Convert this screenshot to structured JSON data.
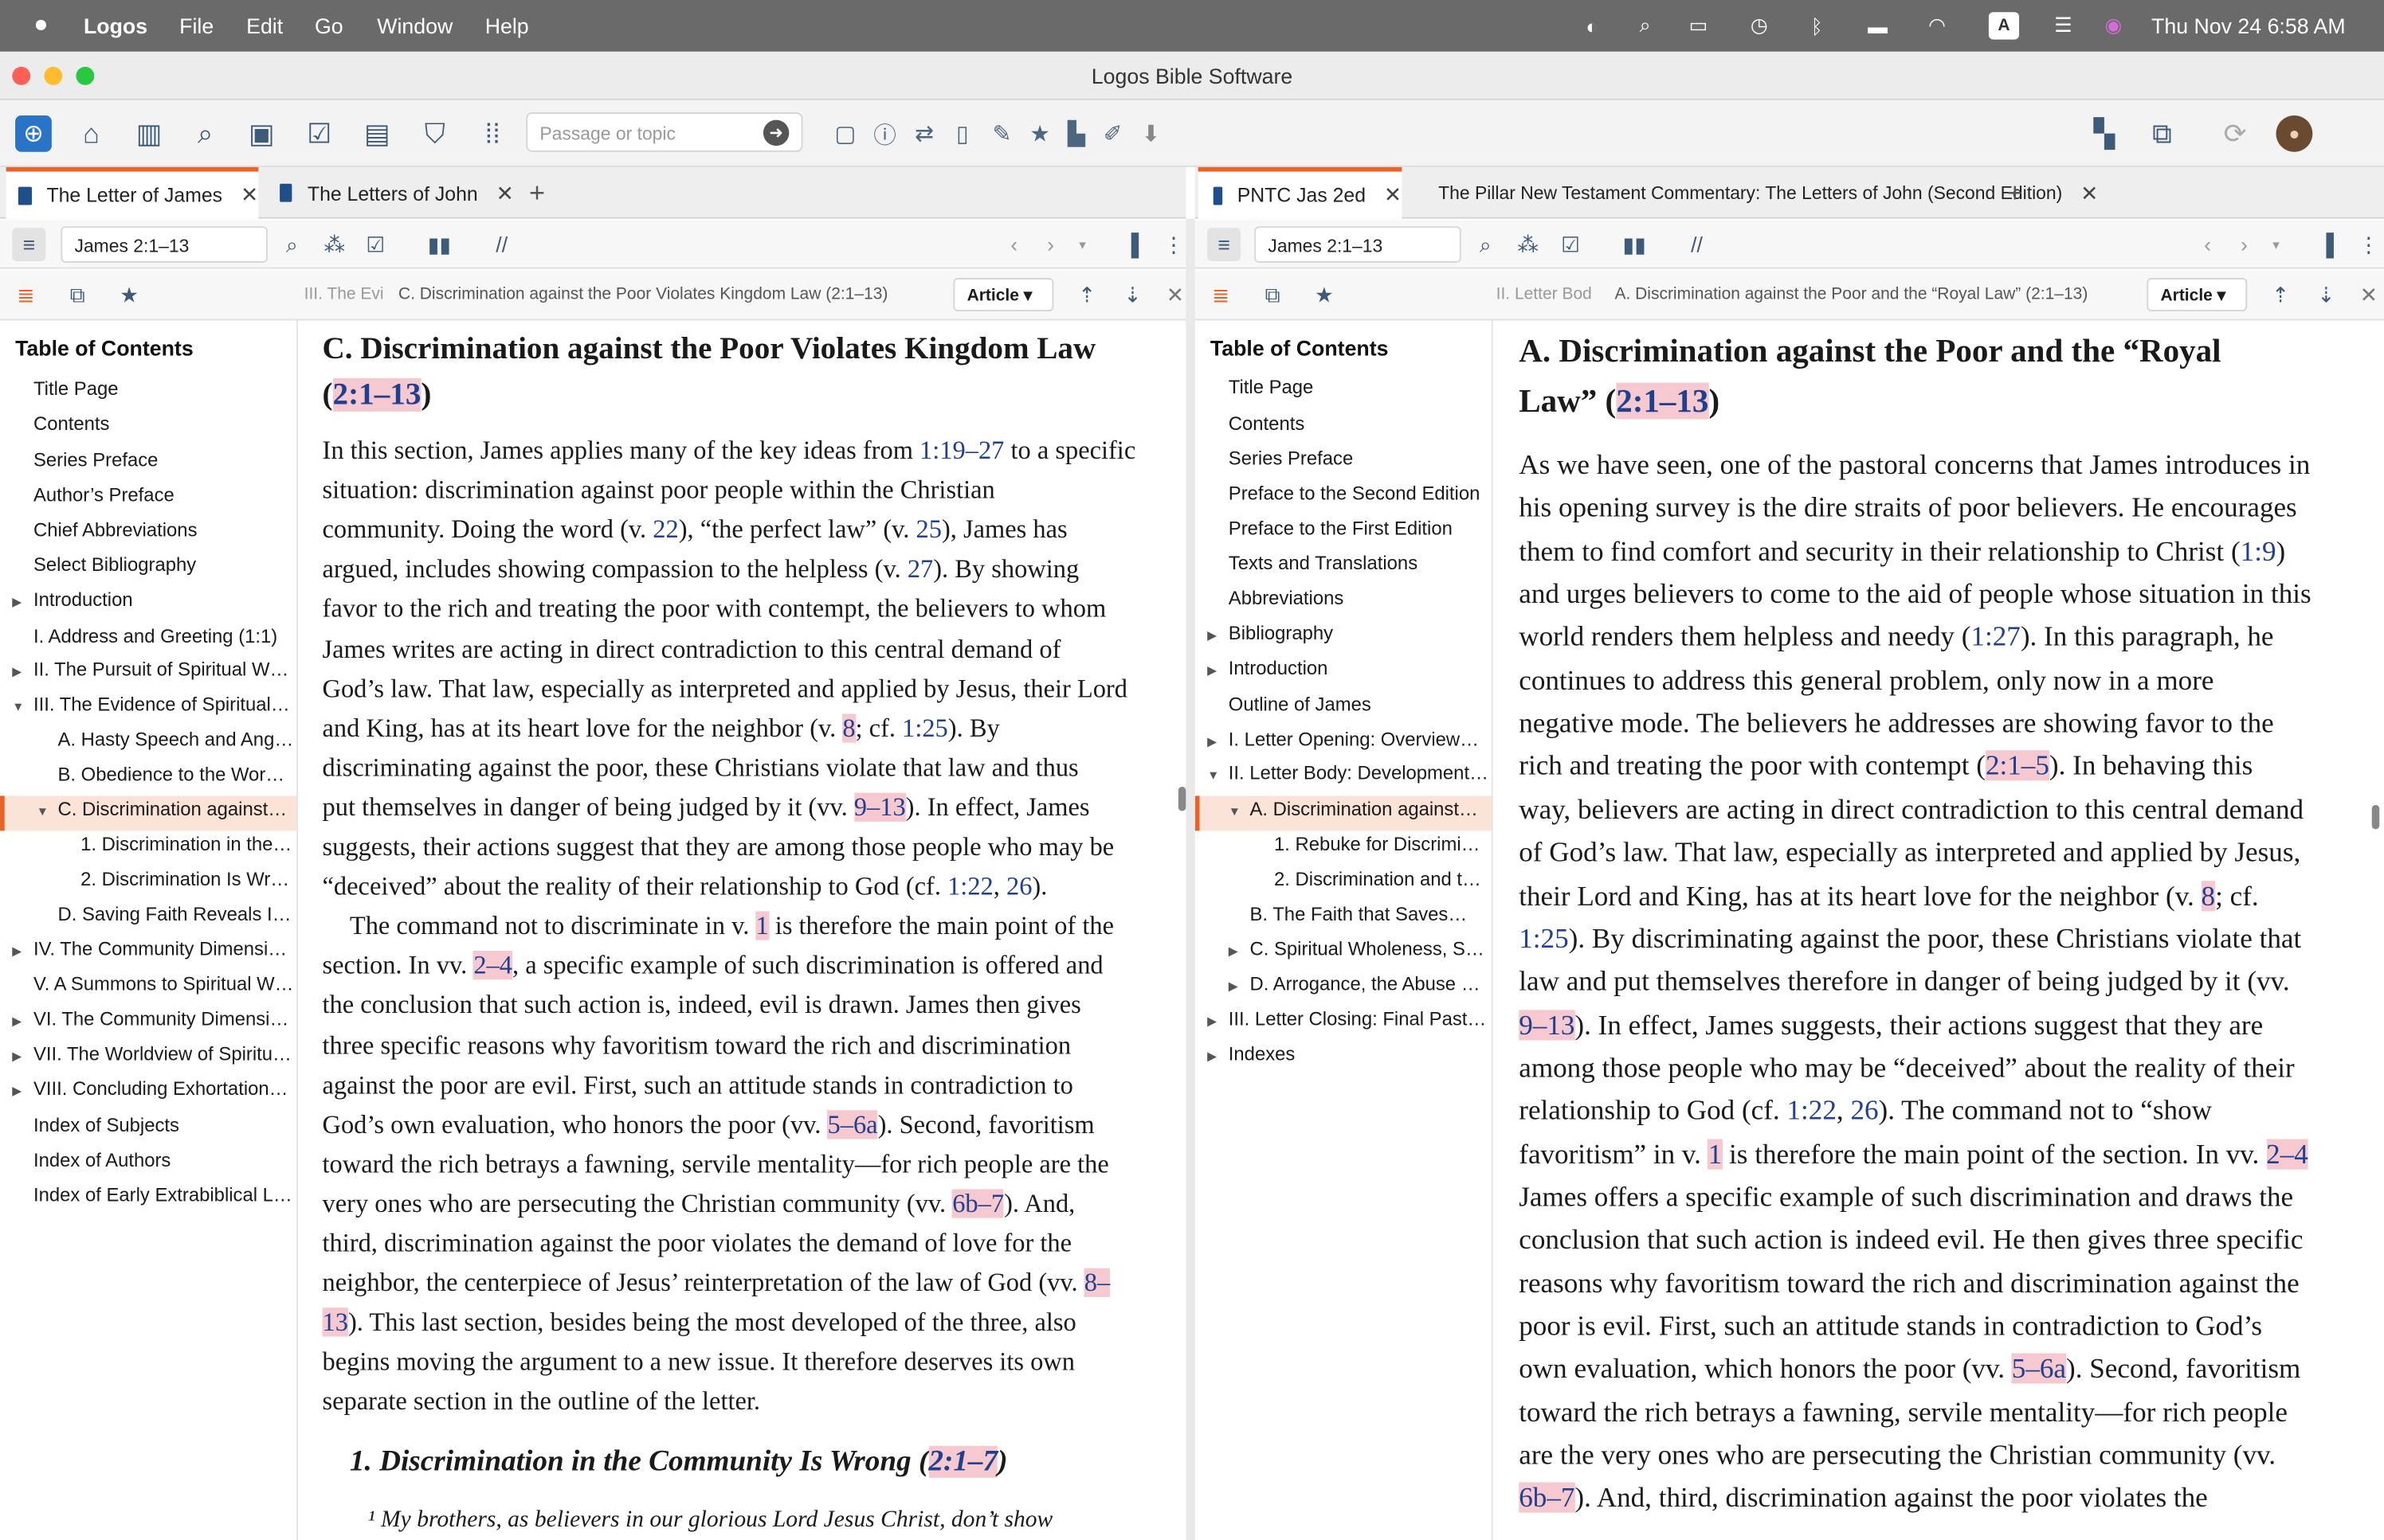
{
  "menubar": {
    "app": "Logos",
    "menus": [
      "File",
      "Edit",
      "Go",
      "Window",
      "Help"
    ],
    "clock": "Thu Nov 24  6:58 AM",
    "input_badge": "A"
  },
  "window": {
    "title": "Logos Bible Software"
  },
  "toolbar": {
    "search_placeholder": "Passage or topic"
  },
  "left": {
    "tabs": [
      "The Letter of James",
      "The Letters of John"
    ],
    "reference": "James 2:1–13",
    "crumb_short": "III. The Evi",
    "crumb": "C. Discrimination against the Poor Violates Kingdom Law (2:1–13)",
    "view_mode": "Article",
    "toc_title": "Table of Contents",
    "toc": [
      "Title Page",
      "Contents",
      "Series Preface",
      "Author’s Preface",
      "Chief Abbreviations",
      "Select Bibliography",
      "Introduction",
      "I. Address and Greeting (1:1)",
      "II. The Pursuit of Spiritual W…",
      "III. The Evidence of Spiritual…",
      "A. Hasty Speech and Ange…",
      "B. Obedience to the Word…",
      "C. Discrimination against…",
      "1. Discrimination in the…",
      "2. Discrimination Is Wr…",
      "D. Saving Faith Reveals Its…",
      "IV. The Community Dimensi…",
      "V. A Summons to Spiritual W…",
      "VI. The Community Dimensi…",
      "VII. The Worldview of Spiritu…",
      "VIII. Concluding Exhortation…",
      "Index of Subjects",
      "Index of Authors",
      "Index of Early Extrabiblical Li…"
    ],
    "heading_l1": "C. Discrimination against the Poor Violates Kingdom Law",
    "heading_ref": "2:1–13",
    "para": [
      [
        "In this section, James applies many of the key ideas from ",
        "1:19–27",
        " to a specific"
      ],
      [
        "situation: discrimination against poor people within the Christian"
      ],
      [
        "community. Doing the word (v. ",
        "22",
        "), “the perfect law” (v. ",
        "25",
        "), James has"
      ],
      [
        "argued, includes showing compassion to the helpless (v. ",
        "27",
        "). By showing"
      ],
      [
        "favor to the rich and treating the poor with contempt, the believers to whom"
      ],
      [
        "James writes are acting in direct contradiction to this central demand of"
      ],
      [
        "God’s law. That law, especially as interpreted and applied by Jesus, their Lord"
      ],
      [
        "and King, has at its heart love for the neighbor (v. ",
        "8",
        "; cf. ",
        "1:25",
        "). By"
      ],
      [
        "discriminating against the poor, these Christians violate that law and thus"
      ],
      [
        "put themselves in danger of being judged by it (vv. ",
        "9–13",
        "). In effect, James"
      ],
      [
        "suggests, their actions suggest that they are among those people who may be"
      ],
      [
        "“deceived” about the reality of their relationship to God (cf. ",
        "1:22",
        ", ",
        "26",
        ")."
      ],
      [
        "The command not to discriminate in v. ",
        "1",
        " is therefore the main point of the"
      ],
      [
        "section. In vv. ",
        "2–4",
        ", a specific example of such discrimination is offered and"
      ],
      [
        "the conclusion that such action is, indeed, evil is drawn. James then gives"
      ],
      [
        "three specific reasons why favoritism toward the rich and discrimination"
      ],
      [
        "against the poor are evil. First, such an attitude stands in contradiction to"
      ],
      [
        "God’s own evaluation, who honors the poor (vv. ",
        "5–6a",
        "). Second, favoritism"
      ],
      [
        "toward the rich betrays a fawning, servile mentality—for rich people are the"
      ],
      [
        "very ones who are persecuting the Christian community (vv. ",
        "6b–7",
        "). And,"
      ],
      [
        "third, discrimination against the poor violates the demand of love for the"
      ],
      [
        "neighbor, the centerpiece of Jesus’ reinterpretation of the law of God (vv. ",
        "8–"
      ],
      [
        "13",
        "). This last section, besides being the most developed of the three, also"
      ],
      [
        "begins moving the argument to a new issue. It therefore deserves its own"
      ],
      [
        "separate section in the outline of the letter."
      ]
    ],
    "subheading": "1. Discrimination in the Community Is Wrong",
    "subheading_ref": "2:1–7",
    "verse": "¹ My brothers, as believers in our glorious Lord Jesus Christ, don’t show"
  },
  "right": {
    "tabs": [
      "PNTC Jas 2ed",
      "The Pillar New Testament Commentary: The Letters of John (Second Edition)"
    ],
    "reference": "James 2:1–13",
    "crumb_short": "II. Letter Bod",
    "crumb": "A. Discrimination against the Poor and the “Royal Law” (2:1–13)",
    "view_mode": "Article",
    "toc_title": "Table of Contents",
    "toc": [
      "Title Page",
      "Contents",
      "Series Preface",
      "Preface to the Second Edition",
      "Preface to the First Edition",
      "Texts and Translations",
      "Abbreviations",
      "Bibliography",
      "Introduction",
      "Outline of James",
      "I. Letter Opening: Overview…",
      "II. Letter Body: Development…",
      "A. Discrimination against…",
      "1. Rebuke for Discrimin…",
      "2. Discrimination and t…",
      "B. The Faith that Saves…",
      "C. Spiritual Wholeness, S…",
      "D. Arrogance, the Abuse o…",
      "III. Letter Closing: Final Past…",
      "Indexes"
    ],
    "heading_l1": "A. Discrimination against the Poor and the “Royal",
    "heading_l2": "Law” (",
    "heading_ref": "2:1–13",
    "para": [
      [
        "As we have seen, one of the pastoral concerns that James introduces in"
      ],
      [
        "his opening survey is the dire straits of poor believers. He encourages"
      ],
      [
        "them to find comfort and security in their relationship to Christ (",
        "1:9",
        ")"
      ],
      [
        "and urges believers to come to the aid of people whose situation in this"
      ],
      [
        "world renders them helpless and needy (",
        "1:27",
        "). In this paragraph, he"
      ],
      [
        "continues to address this general problem, only now in a more"
      ],
      [
        "negative mode. The believers he addresses are showing favor to the"
      ],
      [
        "rich and treating the poor with contempt (",
        "2:1–5",
        "). In behaving this"
      ],
      [
        "way, believers are acting in direct contradiction to this central demand"
      ],
      [
        "of God’s law. That law, especially as interpreted and applied by Jesus,"
      ],
      [
        "their Lord and King, has at its heart love for the neighbor (v. ",
        "8",
        "; cf."
      ],
      [
        "1:25",
        "). By discriminating against the poor, these Christians violate that"
      ],
      [
        "law and put themselves therefore in danger of being judged by it (vv."
      ],
      [
        "9–13",
        "). In effect, James suggests, their actions suggest that they are"
      ],
      [
        "among those people who may be “deceived” about the reality of their"
      ],
      [
        "relationship to God (cf. ",
        "1:22",
        ", ",
        "26",
        "). The command not to “show"
      ],
      [
        "favoritism” in v. ",
        "1",
        " is therefore the main point of the section. In vv. ",
        "2–4"
      ],
      [
        "James offers a specific example of such discrimination and draws the"
      ],
      [
        "conclusion that such action is indeed evil. He then gives three specific"
      ],
      [
        "reasons why favoritism toward the rich and discrimination against the"
      ],
      [
        "poor is evil. First, such an attitude stands in contradiction to God’s"
      ],
      [
        "own evaluation, which honors the poor (vv. ",
        "5–6a",
        "). Second, favoritism"
      ],
      [
        "toward the rich betrays a fawning, servile mentality—for rich people"
      ],
      [
        "are the very ones who are persecuting the Christian community (vv."
      ],
      [
        "6b–7",
        "). And, third, discrimination against the poor violates the"
      ]
    ]
  }
}
